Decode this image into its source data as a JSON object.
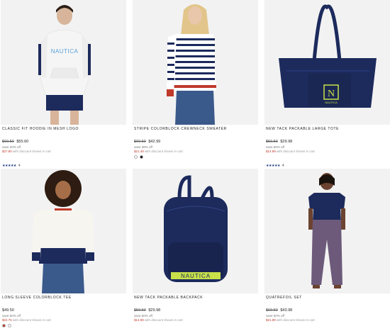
{
  "products": [
    {
      "title": "CLASSIC FIT HOODIE IN MESH LOGO",
      "old_price": "$69.50",
      "price": "$55.60",
      "save": "save 20% off",
      "discount_prefix": "",
      "discount_value": "$27.80",
      "discount_suffix": "with discount shown in cart",
      "rating_stars": "★★★★★",
      "rating_count": "4"
    },
    {
      "title": "STRIPE COLORBLOCK CREWNECK SWEATER",
      "old_price": "$69.50",
      "price": "$42.99",
      "save": "save 38% off",
      "discount_prefix": "",
      "discount_value": "$21.49",
      "discount_suffix": "with discount shown in cart",
      "swatches": [
        "#ffffff",
        "#111111"
      ]
    },
    {
      "title": "NEW TACK PACKABLE LARGE TOTE",
      "old_price": "$59.50",
      "price": "$29.98",
      "save": "save 50% off",
      "discount_prefix": "",
      "discount_value": "$14.99",
      "discount_suffix": "with discount shown in cart",
      "rating_stars": "★★★★★",
      "rating_count": "4"
    },
    {
      "title": "LONG SLEEVE COLORBLOCK TEE",
      "old_price": "",
      "price": "$49.50",
      "save": "save 50% off",
      "discount_prefix": "",
      "discount_value": "$24.75",
      "discount_suffix": "with discount shown in cart",
      "swatches": [
        "#c0392b",
        "#ffffff"
      ]
    },
    {
      "title": "NEW TACK PACKABLE BACKPACK",
      "old_price": "$59.50",
      "price": "$29.98",
      "save": "save 50% off",
      "discount_prefix": "",
      "discount_value": "$14.99",
      "discount_suffix": "with discount shown in cart"
    },
    {
      "title": "QUATREFOIL SET",
      "old_price": "$69.50",
      "price": "$43.98",
      "save": "save 50% off",
      "discount_prefix": "",
      "discount_value": "$21.99",
      "discount_suffix": "with discount shown in cart"
    }
  ],
  "brand_text": {
    "hoodie_logo": "NAUTICA",
    "backpack_logo": "NAUTICA",
    "tote_logo": "N",
    "tote_sublogo": "NAUTICA"
  },
  "colors": {
    "navy": "#1c2a5c",
    "tile_bg": "#f2f2f2",
    "neon": "#c8e04a",
    "star": "#1e3b82"
  }
}
